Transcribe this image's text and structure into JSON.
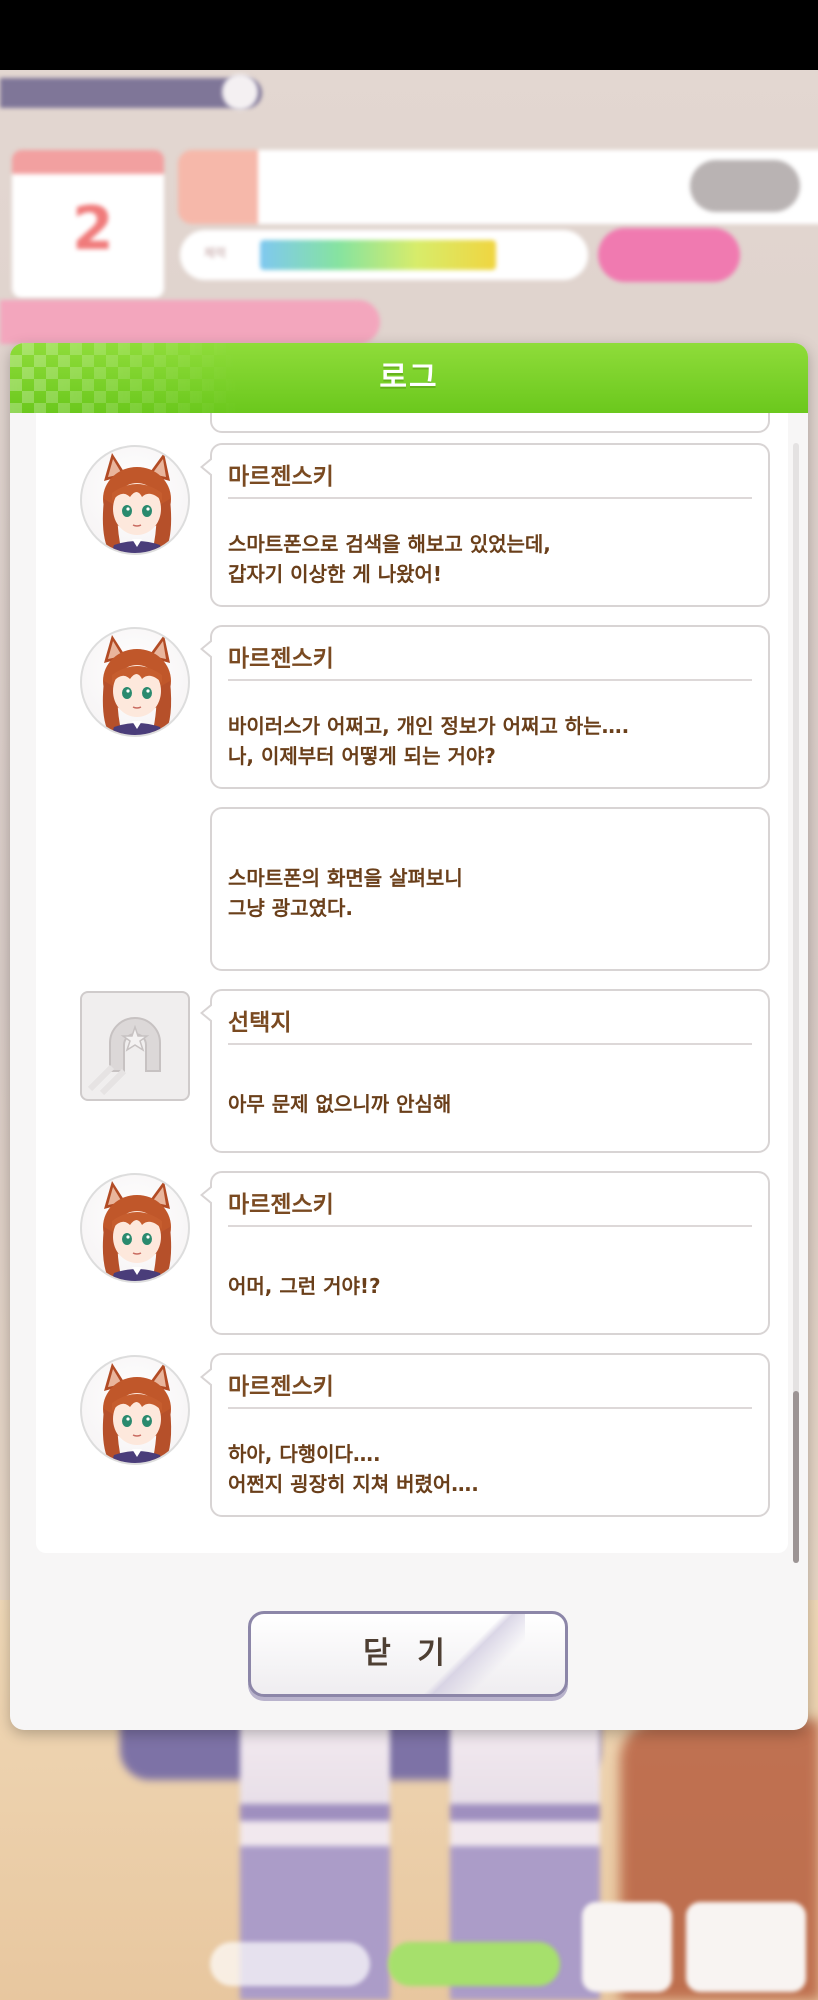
{
  "status_bar": {},
  "dialog": {
    "title": "로그",
    "close_label": "닫 기"
  },
  "log": [
    {
      "speaker": "마르젠스키",
      "text": "스마트폰으로 검색을 해보고 있었는데,\n갑자기 이상한 게 나왔어!",
      "avatar": "character-portrait"
    },
    {
      "speaker": "마르젠스키",
      "text": "바이러스가 어쩌고, 개인 정보가 어쩌고 하는….\n나, 이제부터 어떻게 되는 거야?",
      "avatar": "character-portrait"
    },
    {
      "speaker": "",
      "text": "스마트폰의 화면을 살펴보니\n그냥 광고였다.",
      "avatar": "none"
    },
    {
      "speaker": "선택지",
      "text": "아무 문제 없으니까 안심해",
      "avatar": "choice-placeholder-icon"
    },
    {
      "speaker": "마르젠스키",
      "text": "어머, 그런 거야!?",
      "avatar": "character-portrait"
    },
    {
      "speaker": "마르젠스키",
      "text": "하아, 다행이다….\n어쩐지 굉장히 지쳐 버렸어….",
      "avatar": "character-portrait"
    }
  ],
  "background": {
    "turn_number": "2",
    "energy_label": "체력"
  },
  "colors": {
    "header_green": "#7ad02a",
    "text_brown": "#6a3f1a",
    "button_border": "#8c86a8"
  }
}
